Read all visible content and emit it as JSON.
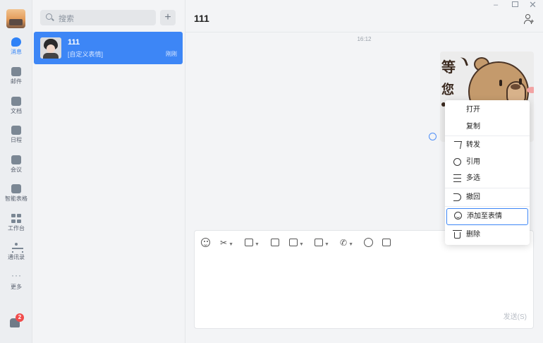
{
  "rail": {
    "items": [
      {
        "label": "消息",
        "icon": "chat-bubble-icon",
        "active": true
      },
      {
        "label": "邮件",
        "icon": "mail-icon"
      },
      {
        "label": "文档",
        "icon": "document-icon"
      },
      {
        "label": "日程",
        "icon": "calendar-icon"
      },
      {
        "label": "会议",
        "icon": "meeting-icon"
      },
      {
        "label": "智能表格",
        "icon": "smart-sheet-icon"
      },
      {
        "label": "工作台",
        "icon": "workbench-icon"
      },
      {
        "label": "通讯录",
        "icon": "contacts-icon"
      },
      {
        "label": "更多",
        "icon": "more-icon"
      }
    ],
    "badge_count": "2"
  },
  "list": {
    "search_placeholder": "搜索",
    "add_label": "+",
    "conversations": [
      {
        "name": "111",
        "preview": "[自定义表情]",
        "time": "刚刚"
      }
    ]
  },
  "chat": {
    "title": "111",
    "timestamp": "16:12",
    "window_min": "–",
    "window_close": "✕",
    "send_label": "发送(S)"
  },
  "context_menu": {
    "items": [
      {
        "label": "打开"
      },
      {
        "label": "复制"
      },
      {
        "label": "转发",
        "icon": "forward-icon"
      },
      {
        "label": "引用",
        "icon": "quote-icon"
      },
      {
        "label": "多选",
        "icon": "multi-select-icon"
      },
      {
        "label": "撤回",
        "icon": "undo-icon"
      },
      {
        "label": "添加至表情",
        "icon": "smile-icon",
        "highlighted": true
      },
      {
        "label": "删除",
        "icon": "trash-icon"
      }
    ]
  },
  "colors": {
    "accent": "#3d86f6",
    "badge": "#f14c4c"
  }
}
